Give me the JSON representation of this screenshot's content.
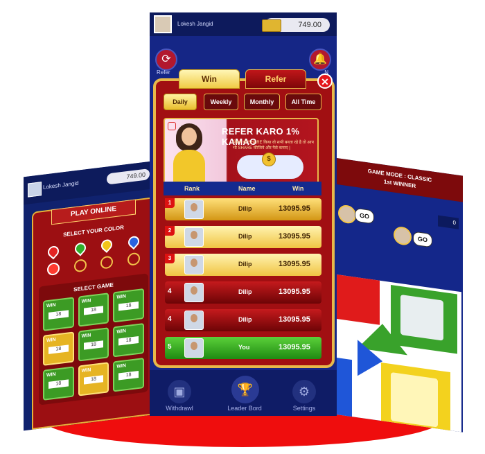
{
  "left_screen": {
    "user_name": "Lokesh Jangid",
    "coins": "749.00",
    "title": "PLAY ONLINE",
    "select_color_label": "SELECT YOUR COLOR",
    "select_game_label": "SELECT GAME",
    "cards": [
      {
        "label": "WIN",
        "value": "18"
      },
      {
        "label": "WIN",
        "value": "18"
      },
      {
        "label": "WIN",
        "value": "18"
      },
      {
        "label": "WIN",
        "value": "18"
      },
      {
        "label": "WIN",
        "value": "18"
      },
      {
        "label": "WIN",
        "value": "18"
      },
      {
        "label": "WIN",
        "value": "18"
      },
      {
        "label": "WIN",
        "value": "18"
      },
      {
        "label": "WIN",
        "value": "18"
      }
    ]
  },
  "center_screen": {
    "user_name": "Lokesh Jangid",
    "coins": "749.00",
    "side_left_label": "Refer",
    "side_right_label": "N",
    "tabs": {
      "win": "Win",
      "refer": "Refer"
    },
    "filters": {
      "daily": "Daily",
      "weekly": "Weekly",
      "monthly": "Monthly",
      "all_time": "All Time"
    },
    "banner": {
      "title": "REFER KARO 1% KAMAO",
      "subtitle": "जितने भी SHARE किया वो सभी बनता रहे है तो आप भी SHARE कीजिये और पैसे कमाए |",
      "coin_symbol": "$"
    },
    "table_header": {
      "rank": "Rank",
      "name": "Name",
      "win": "Win"
    },
    "rows": [
      {
        "rank": "1",
        "name": "Dilip",
        "score": "13095.95"
      },
      {
        "rank": "2",
        "name": "Dilip",
        "score": "13095.95"
      },
      {
        "rank": "3",
        "name": "Dilip",
        "score": "13095.95"
      },
      {
        "rank": "4",
        "name": "Dilip",
        "score": "13095.95"
      },
      {
        "rank": "4",
        "name": "Dilip",
        "score": "13095.95"
      },
      {
        "rank": "5",
        "name": "You",
        "score": "13095.95"
      }
    ],
    "bottom_nav": {
      "withdraw": "Withdrawl",
      "leaderboard": "Leader Bord",
      "settings": "Settings"
    }
  },
  "right_screen": {
    "game_mode": "GAME MODE : CLASSIC",
    "winner": "1st WINNER",
    "go_label": "GO",
    "coin_count": "0"
  },
  "colors": {
    "primary_red": "#a10f12",
    "gold": "#e7b94a",
    "navy": "#152686",
    "disc": "#ef0d0d"
  }
}
